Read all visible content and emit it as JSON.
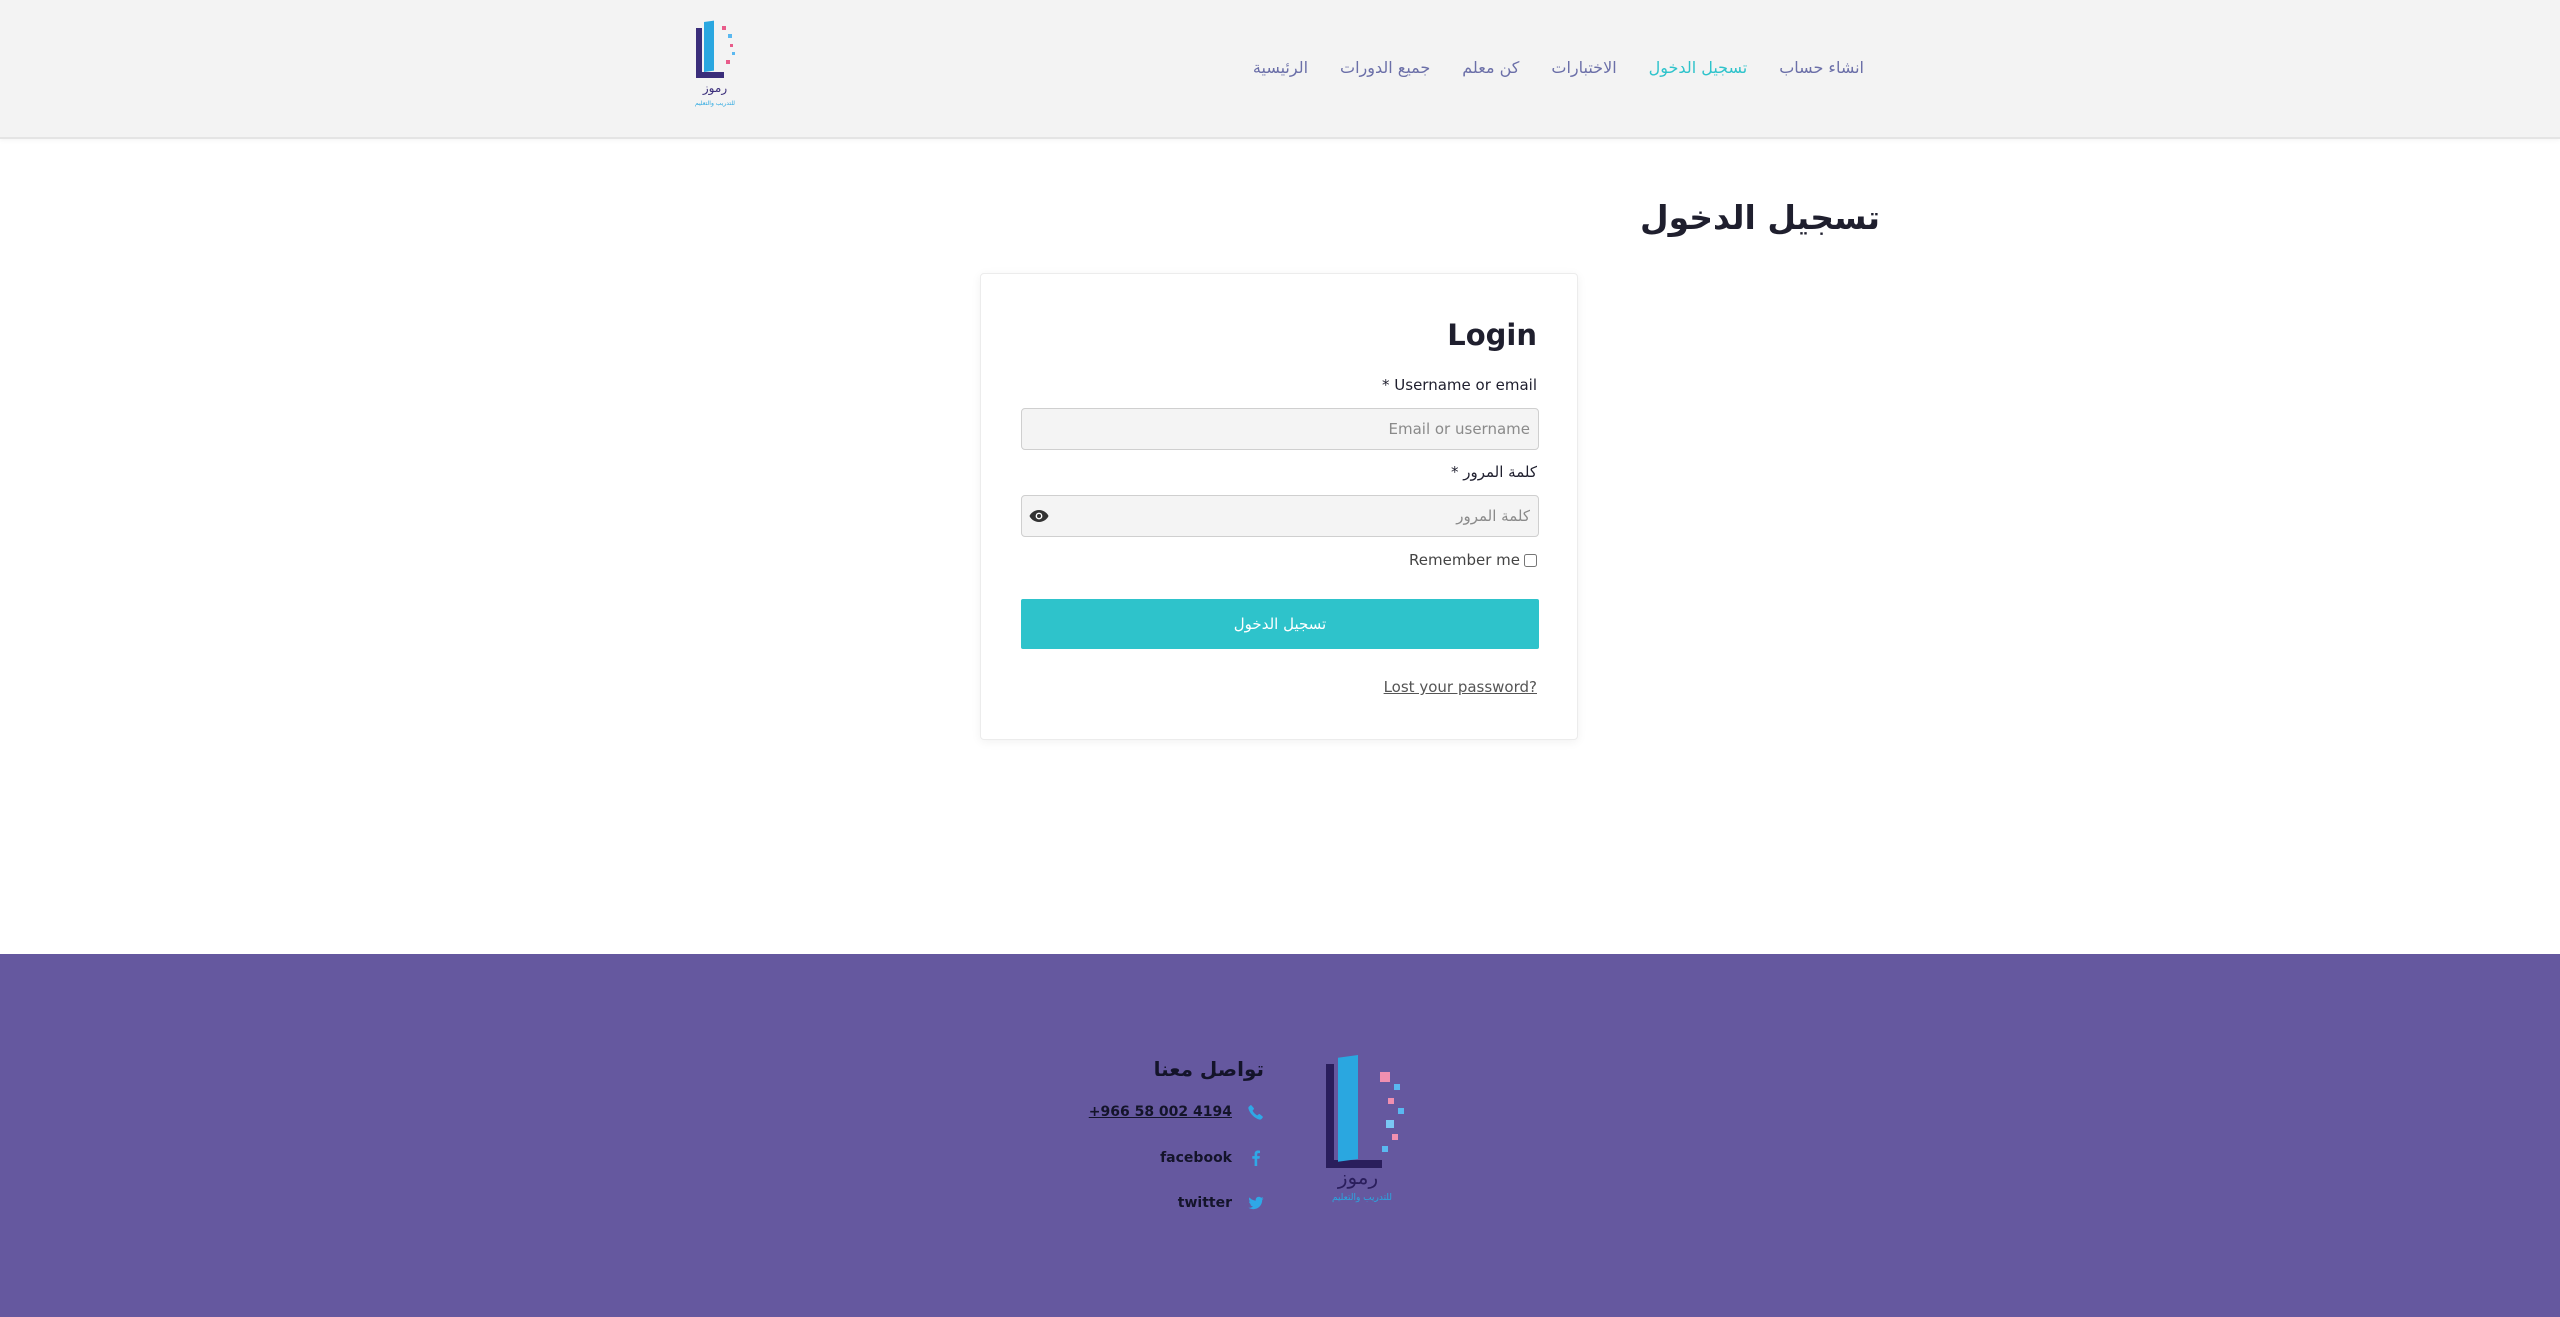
{
  "brand": {
    "logo_text": "رموز",
    "logo_subtext": "للتدريب والتعليم"
  },
  "nav": {
    "items": [
      {
        "label": "الرئيسية",
        "active": false
      },
      {
        "label": "جميع الدورات",
        "active": false
      },
      {
        "label": "كن معلم",
        "active": false
      },
      {
        "label": "الاختبارات",
        "active": false
      },
      {
        "label": "تسجيل الدخول",
        "active": true
      },
      {
        "label": "انشاء حساب",
        "active": false
      }
    ]
  },
  "page": {
    "title": "تسجيل الدخول"
  },
  "login": {
    "title": "Login",
    "username_label": "Username or email",
    "username_placeholder": "Email or username",
    "username_value": "",
    "password_label": "كلمة المرور",
    "password_placeholder": "كلمة المرور",
    "password_value": "",
    "required_mark": "*",
    "remember_label": "Remember me",
    "remember_checked": false,
    "submit_label": "تسجيل الدخول",
    "lost_password": "Lost your password?"
  },
  "footer": {
    "contact_title": "تواصل معنا",
    "phone": "+966 58 002 4194",
    "facebook": "facebook",
    "twitter": "twitter"
  },
  "colors": {
    "accent": "#2ec3cb",
    "nav_text": "#6b6fa8",
    "footer_bg": "#65589f",
    "header_bg": "#f3f3f3"
  },
  "icons": {
    "password_toggle": "eye-icon",
    "phone": "phone-icon",
    "facebook": "facebook-icon",
    "twitter": "twitter-icon"
  }
}
